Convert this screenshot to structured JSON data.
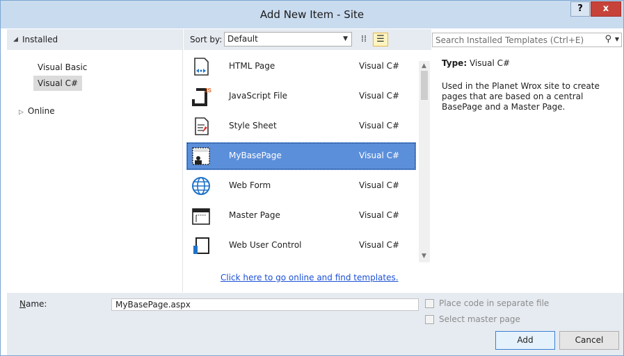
{
  "window": {
    "title": "Add New Item - Site",
    "help_label": "?",
    "close_label": "x"
  },
  "left": {
    "installed_label": "Installed",
    "items": [
      {
        "label": "Visual Basic"
      },
      {
        "label": "Visual C#",
        "selected": true
      }
    ],
    "online_label": "Online"
  },
  "center": {
    "sort_label_prefix": "Sort by: ",
    "sort_value": "Default",
    "templates": [
      {
        "name": "HTML Page",
        "language": "Visual C#",
        "icon": "html-page-icon"
      },
      {
        "name": "JavaScript File",
        "language": "Visual C#",
        "icon": "javascript-file-icon"
      },
      {
        "name": "Style Sheet",
        "language": "Visual C#",
        "icon": "style-sheet-icon"
      },
      {
        "name": "MyBasePage",
        "language": "Visual C#",
        "icon": "base-page-icon",
        "selected": true
      },
      {
        "name": "Web Form",
        "language": "Visual C#",
        "icon": "web-form-icon"
      },
      {
        "name": "Master Page",
        "language": "Visual C#",
        "icon": "master-page-icon"
      },
      {
        "name": "Web User Control",
        "language": "Visual C#",
        "icon": "web-user-control-icon"
      }
    ],
    "online_link": "Click here to go online and find templates."
  },
  "right": {
    "search_placeholder": "Search Installed Templates (Ctrl+E)",
    "type_label": "Type:",
    "type_value": "Visual C#",
    "description": "Used in the Planet Wrox site to create pages that are based on a central BasePage and a Master Page."
  },
  "bottom": {
    "name_label": "Name:",
    "name_value": "MyBasePage.aspx",
    "checkbox_code_label": "Place code in separate file",
    "checkbox_master_label": "Select master page",
    "add_label": "Add",
    "cancel_label": "Cancel"
  },
  "colors": {
    "accent": "#5c8fda",
    "header_bg": "#e6ebf1",
    "title_bg": "#c9dbef",
    "close_red": "#c7433a",
    "link": "#1a4fd6"
  }
}
